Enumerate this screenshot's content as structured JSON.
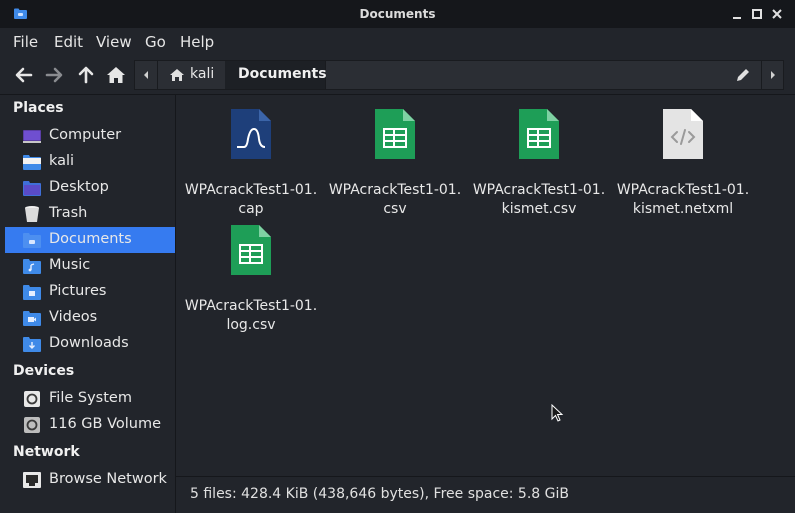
{
  "window": {
    "title": "Documents"
  },
  "menubar": {
    "items": [
      "File",
      "Edit",
      "View",
      "Go",
      "Help"
    ]
  },
  "pathbar": {
    "crumbs": [
      "kali",
      "Documents"
    ]
  },
  "sidebar": {
    "sections": {
      "places": "Places",
      "devices": "Devices",
      "network": "Network"
    },
    "places": [
      {
        "label": "Computer",
        "icon": "computer-icon"
      },
      {
        "label": "kali",
        "icon": "home-folder-icon"
      },
      {
        "label": "Desktop",
        "icon": "desktop-folder-icon"
      },
      {
        "label": "Trash",
        "icon": "trash-icon"
      },
      {
        "label": "Documents",
        "icon": "documents-folder-icon",
        "selected": true
      },
      {
        "label": "Music",
        "icon": "music-folder-icon"
      },
      {
        "label": "Pictures",
        "icon": "pictures-folder-icon"
      },
      {
        "label": "Videos",
        "icon": "videos-folder-icon"
      },
      {
        "label": "Downloads",
        "icon": "downloads-folder-icon"
      }
    ],
    "devices": [
      {
        "label": "File System",
        "icon": "drive-icon"
      },
      {
        "label": "116 GB Volume",
        "icon": "drive-icon"
      }
    ],
    "network": [
      {
        "label": "Browse Network",
        "icon": "network-icon"
      }
    ]
  },
  "files": [
    {
      "line1": "WPAcrackTest1-01.",
      "line2": "cap",
      "type": "cap-file-icon"
    },
    {
      "line1": "WPAcrackTest1-01.",
      "line2": "csv",
      "type": "spreadsheet-icon"
    },
    {
      "line1": "WPAcrackTest1-01.",
      "line2": "kismet.csv",
      "type": "spreadsheet-icon"
    },
    {
      "line1": "WPAcrackTest1-01.",
      "line2": "kismet.netxml",
      "type": "xml-file-icon"
    },
    {
      "line1": "WPAcrackTest1-01.",
      "line2": "log.csv",
      "type": "spreadsheet-icon"
    }
  ],
  "status": {
    "text": "5 files: 428.4 KiB (438,646 bytes), Free space: 5.8 GiB"
  },
  "colors": {
    "accent": "#367bf0",
    "sheet": "#1e9e57",
    "cap": "#1e3f7a"
  }
}
